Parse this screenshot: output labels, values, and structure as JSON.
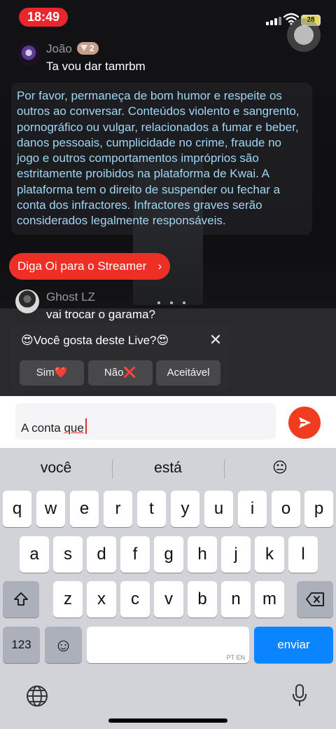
{
  "status_bar": {
    "time": "18:49",
    "battery": "28"
  },
  "chat": {
    "messages": [
      {
        "name": "João",
        "badge": "2",
        "text": "Ta vou dar tamrbm"
      },
      {
        "name": "Ghost LZ",
        "text": "vai trocar o garama?"
      }
    ],
    "notice": "Por favor, permaneça de bom humor e respeite os outros ao conversar. Conteúdos violento e sangrento, pornográfico ou vulgar, relacionados a fumar e beber, danos pessoais, cumplicidade no crime, fraude no jogo e outros comportamentos impróprios são estritamente proibidos na plataforma de Kwai. A plataforma tem o direito de suspender ou fechar a conta dos infractores. Infractores graves serão considerados legalmente responsáveis.",
    "greet_button": "Diga Oi para o Streamer",
    "greet_chevron": "›"
  },
  "poll": {
    "title": "😍Você gosta deste Live?😍",
    "close": "✕",
    "options": [
      "Sim❤️",
      "Não❌",
      "Aceitável"
    ]
  },
  "input": {
    "text_prefix": "A conta ",
    "text_word": "que"
  },
  "keyboard": {
    "suggestions": [
      "você",
      "está",
      "😐"
    ],
    "row1": [
      "q",
      "w",
      "e",
      "r",
      "t",
      "y",
      "u",
      "i",
      "o",
      "p"
    ],
    "row2": [
      "a",
      "s",
      "d",
      "f",
      "g",
      "h",
      "j",
      "k",
      "l"
    ],
    "row3": [
      "z",
      "x",
      "c",
      "v",
      "b",
      "n",
      "m"
    ],
    "numbers_key": "123",
    "space_hint": "PT EN",
    "send_key": "enviar",
    "emoji_key": "☺"
  },
  "colors": {
    "accent": "#ee2f25",
    "notice_text": "#9fd6f4",
    "keyboard_blue": "#0a84ff"
  }
}
